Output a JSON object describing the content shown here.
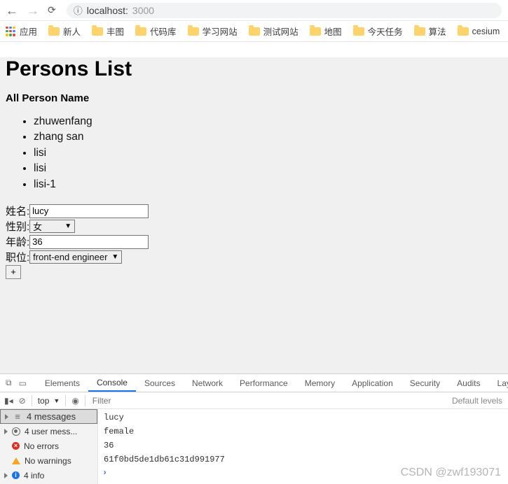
{
  "browser": {
    "info_icon": "ⓘ",
    "url_host": "localhost:",
    "url_port": "3000"
  },
  "bookmarks": {
    "apps_label": "应用",
    "items": [
      "新人",
      "丰图",
      "代码库",
      "学习网站",
      "测试网站",
      "地图",
      "今天任务",
      "算法",
      "cesium"
    ]
  },
  "page": {
    "title": "Persons List",
    "subtitle": "All Person Name",
    "persons": [
      "zhuwenfang",
      "zhang san",
      "lisi",
      "lisi",
      "lisi-1"
    ],
    "form": {
      "name_label": "姓名:",
      "name_value": "lucy",
      "gender_label": "性别:",
      "gender_value": "女",
      "age_label": "年龄:",
      "age_value": "36",
      "job_label": "职位:",
      "job_value": "front-end engineer",
      "add_label": "+"
    }
  },
  "devtools": {
    "tabs": [
      "Elements",
      "Console",
      "Sources",
      "Network",
      "Performance",
      "Memory",
      "Application",
      "Security",
      "Audits",
      "Lay"
    ],
    "active_tab": "Console",
    "scope": "top",
    "filter_placeholder": "Filter",
    "levels_label": "Default levels",
    "sidebar": {
      "messages": "4 messages",
      "user_messages": "4 user mess...",
      "no_errors": "No errors",
      "no_warnings": "No warnings",
      "info": "4 info"
    },
    "console_lines": [
      "lucy",
      "female",
      "36",
      "61f0bd5de1db61c31d991977"
    ]
  },
  "watermark": "CSDN @zwf193071"
}
